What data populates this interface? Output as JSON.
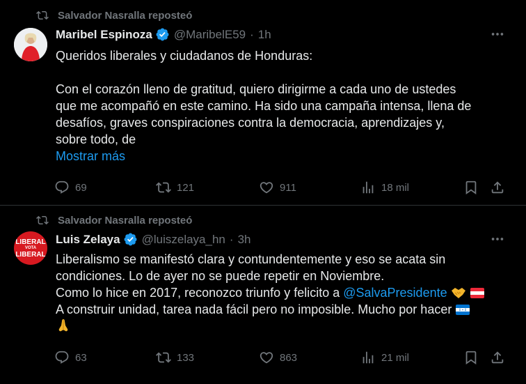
{
  "tweets": [
    {
      "repost_label": "Salvador Nasralla reposteó",
      "name": "Maribel Espinoza",
      "handle": "@MaribelE59",
      "time": "1h",
      "lines": [
        "Queridos liberales y ciudadanos de Honduras:",
        "",
        "Con el corazón lleno de gratitud, quiero dirigirme a cada uno de ustedes",
        "que me acompañó en este camino. Ha sido una campaña intensa, llena de",
        "desafíos, graves conspiraciones contra la democracia, aprendizajes y,",
        "sobre todo, de"
      ],
      "show_more": "Mostrar más",
      "replies": "69",
      "reposts": "121",
      "likes": "911",
      "views": "18 mil"
    },
    {
      "repost_label": "Salvador Nasralla reposteó",
      "name": "Luis Zelaya",
      "handle": "@luiszelaya_hn",
      "time": "3h",
      "avatar_text": [
        "LIBERAL",
        "VOTA",
        "LIBERAL"
      ],
      "lines": [
        "Liberalismo se manifestó clara y contundentemente y eso se acata sin",
        "condiciones. Lo de ayer no se puede repetir en Noviembre.",
        "Como lo hice en 2017, reconozco triunfo y felicito a",
        "A construir unidad, tarea nada fácil pero no imposible. Mucho por hacer"
      ],
      "mention": "@SalvaPresidente",
      "replies": "63",
      "reposts": "133",
      "likes": "863",
      "views": "21 mil"
    }
  ],
  "colors": {
    "background": "#000000",
    "text": "#e7e9ea",
    "muted": "#71767b",
    "accent": "#1d9bf0",
    "divider": "#2f3336"
  },
  "icons": [
    "repost-icon",
    "verified-badge-icon",
    "more-icon",
    "reply-icon",
    "retweet-icon",
    "like-icon",
    "views-icon",
    "bookmark-icon",
    "share-icon"
  ]
}
